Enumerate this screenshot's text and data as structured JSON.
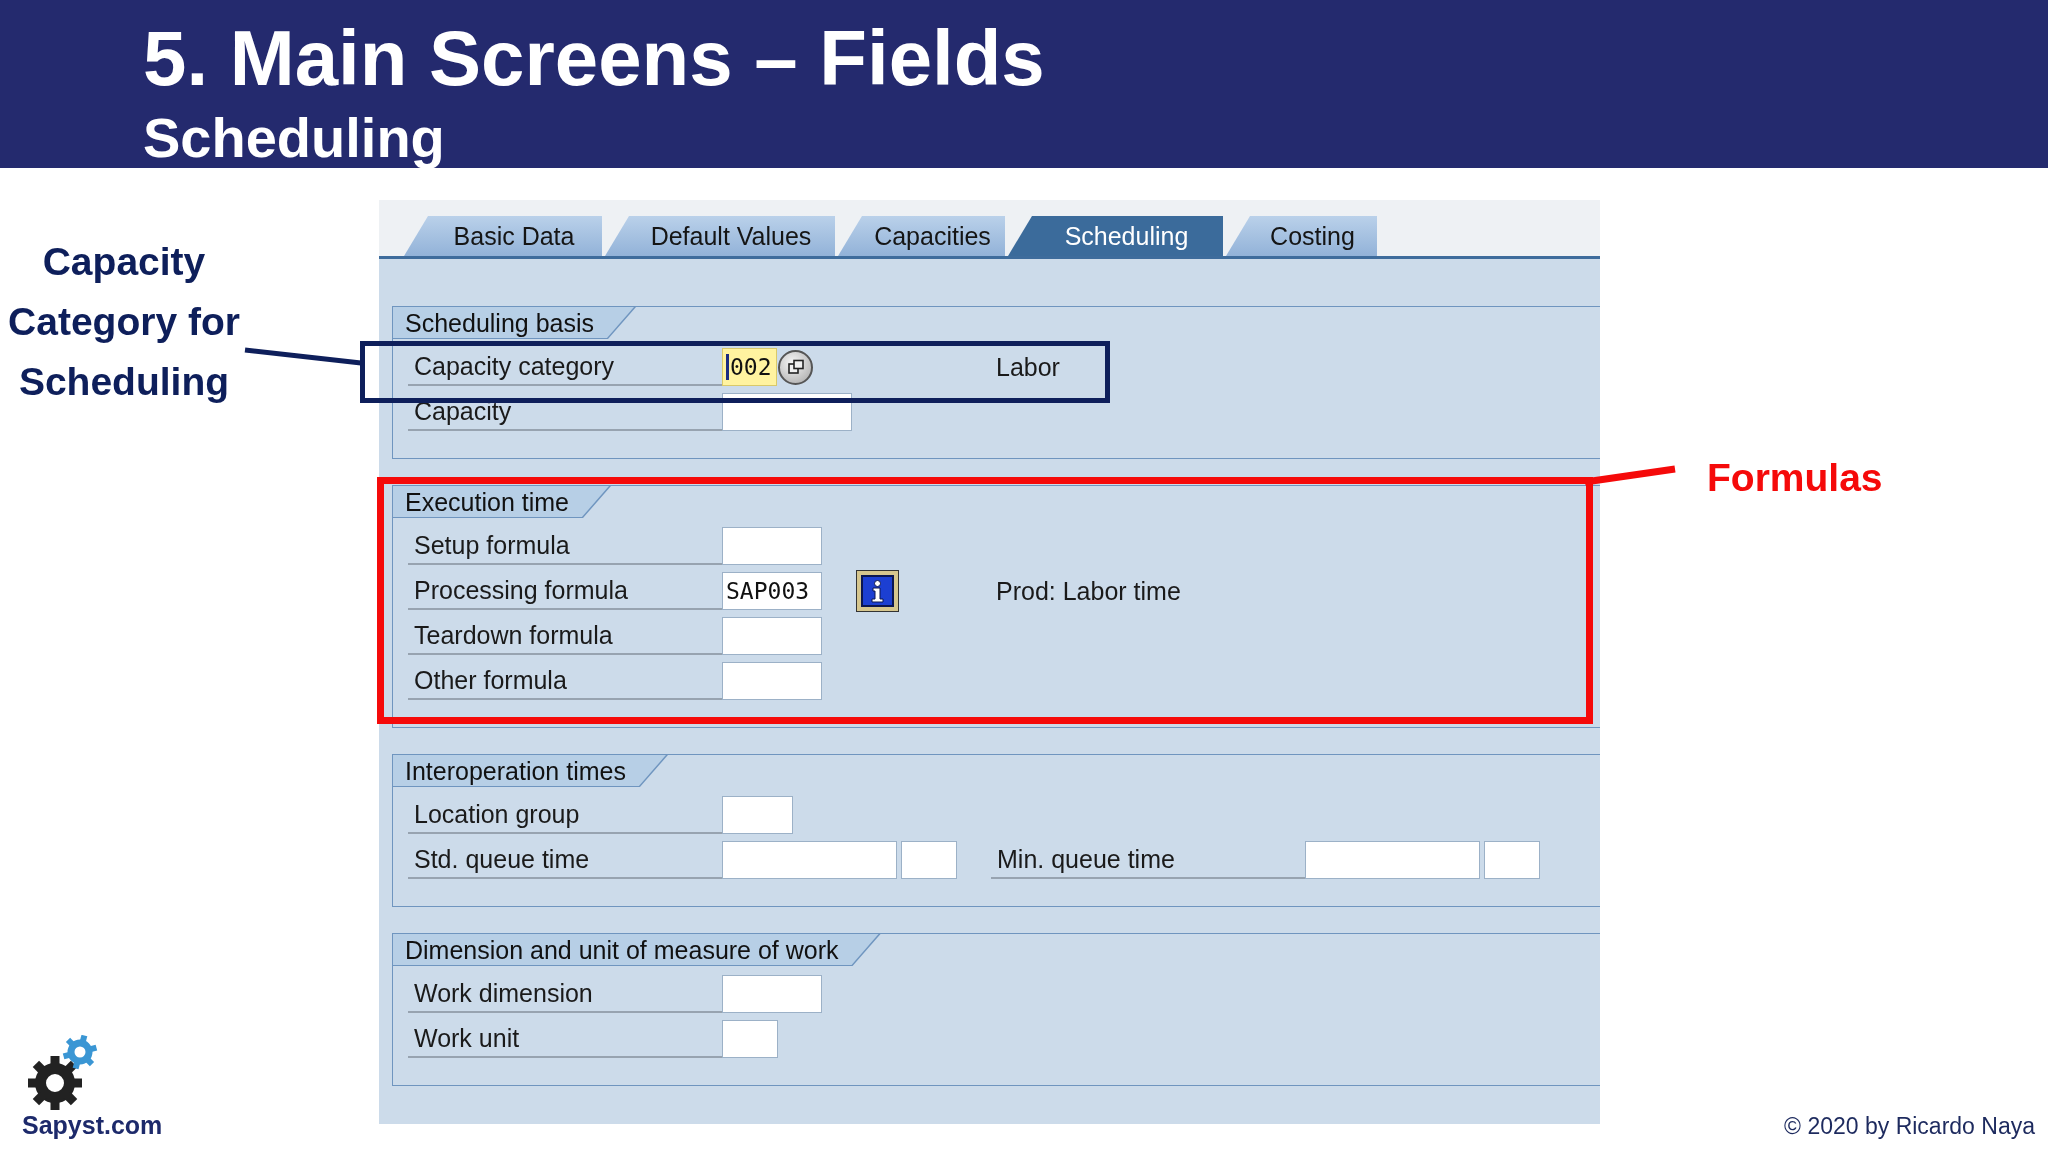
{
  "slide": {
    "title": "5. Main Screens – Fields",
    "subtitle": "Scheduling"
  },
  "annotations": [
    {
      "text": "Capacity Category for Scheduling",
      "color": "#0e1f5b"
    },
    {
      "text": "Formulas",
      "color": "#f50a0a"
    }
  ],
  "tabs": [
    {
      "label": "Basic Data",
      "selected": false
    },
    {
      "label": "Default Values",
      "selected": false
    },
    {
      "label": "Capacities",
      "selected": false
    },
    {
      "label": "Scheduling",
      "selected": true
    },
    {
      "label": "Costing",
      "selected": false
    }
  ],
  "groups": [
    {
      "title": "Scheduling basis",
      "rows": [
        {
          "fields": [
            {
              "kind": "entry",
              "label": "Capacity category",
              "value": "002",
              "focused": true,
              "button": {
                "kind": "value_help"
              },
              "description": "Labor"
            }
          ]
        },
        {
          "fields": [
            {
              "kind": "entry",
              "label": "Capacity",
              "focused": false
            }
          ]
        }
      ]
    },
    {
      "title": "Execution time",
      "rows": [
        {
          "fields": [
            {
              "kind": "entry",
              "label": "Setup formula",
              "focused": false
            }
          ]
        },
        {
          "fields": [
            {
              "kind": "entry",
              "label": "Processing formula",
              "value": "SAP003",
              "focused": false,
              "button": {
                "kind": "info"
              },
              "description": "Prod: Labor time"
            }
          ]
        },
        {
          "fields": [
            {
              "kind": "entry",
              "label": "Teardown formula",
              "focused": false
            }
          ]
        },
        {
          "fields": [
            {
              "kind": "entry",
              "label": "Other formula",
              "focused": false
            }
          ]
        }
      ]
    },
    {
      "title": "Interoperation times",
      "rows": [
        {
          "fields": [
            {
              "kind": "entry",
              "label": "Location group",
              "focused": false
            }
          ]
        },
        {
          "fields": [
            {
              "kind": "quantity",
              "label": "Std. queue time",
              "focused": false
            },
            {
              "kind": "quantity",
              "label": "Min. queue time",
              "focused": false
            }
          ]
        }
      ]
    },
    {
      "title": "Dimension and unit of measure of work",
      "rows": [
        {
          "fields": [
            {
              "kind": "entry",
              "label": "Work dimension",
              "focused": false
            }
          ]
        },
        {
          "fields": [
            {
              "kind": "entry",
              "label": "Work unit",
              "focused": false
            }
          ]
        }
      ]
    }
  ],
  "logo": {
    "text": "Sapyst.com"
  },
  "copyright": "© 2020 by Ricardo Naya"
}
